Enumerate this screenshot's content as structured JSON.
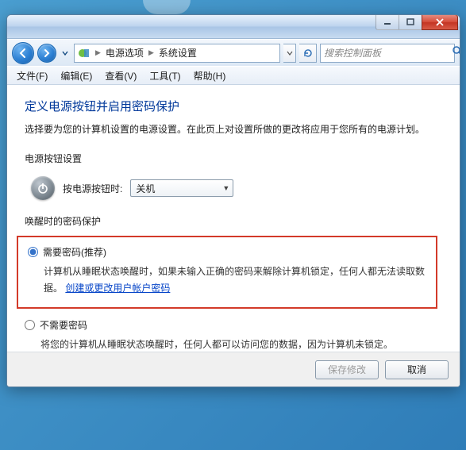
{
  "window": {
    "min_tip": "最小化",
    "max_tip": "最大化",
    "close_tip": "关闭"
  },
  "breadcrumb": {
    "item1": "电源选项",
    "item2": "系统设置"
  },
  "search": {
    "placeholder": "搜索控制面板"
  },
  "menubar": {
    "file": "文件(F)",
    "edit": "编辑(E)",
    "view": "查看(V)",
    "tools": "工具(T)",
    "help": "帮助(H)"
  },
  "page": {
    "title": "定义电源按钮并启用密码保护",
    "subtitle": "选择要为您的计算机设置的电源设置。在此页上对设置所做的更改将应用于您所有的电源计划。",
    "section_power": "电源按钮设置",
    "power_label": "按电源按钮时:",
    "power_value": "关机",
    "section_wake": "唤醒时的密码保护",
    "opt1_label": "需要密码(推荐)",
    "opt1_desc_a": "计算机从睡眠状态唤醒时，如果未输入正确的密码来解除计算机锁定，任何人都无法读取数据。",
    "opt1_link": "创建或更改用户帐户密码",
    "opt2_label": "不需要密码",
    "opt2_desc": "将您的计算机从睡眠状态唤醒时，任何人都可以访问您的数据，因为计算机未锁定。"
  },
  "footer": {
    "save": "保存修改",
    "cancel": "取消"
  },
  "icons": {
    "back": "back-arrow",
    "forward": "forward-arrow",
    "control_panel": "control-panel-icon",
    "refresh": "refresh-icon",
    "search": "search-icon",
    "power": "power-icon"
  }
}
